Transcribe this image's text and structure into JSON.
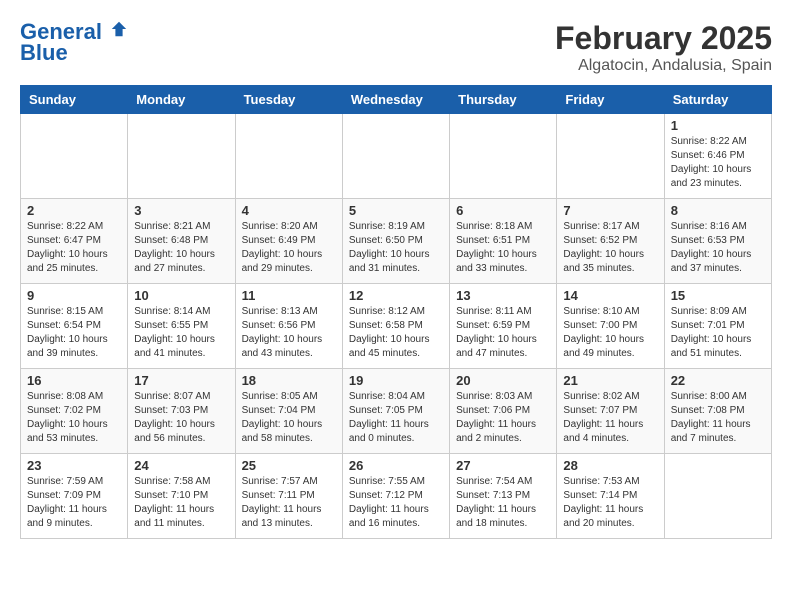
{
  "header": {
    "logo_line1": "General",
    "logo_line2": "Blue",
    "title": "February 2025",
    "subtitle": "Algatocin, Andalusia, Spain"
  },
  "columns": [
    "Sunday",
    "Monday",
    "Tuesday",
    "Wednesday",
    "Thursday",
    "Friday",
    "Saturday"
  ],
  "weeks": [
    [
      {
        "day": "",
        "info": ""
      },
      {
        "day": "",
        "info": ""
      },
      {
        "day": "",
        "info": ""
      },
      {
        "day": "",
        "info": ""
      },
      {
        "day": "",
        "info": ""
      },
      {
        "day": "",
        "info": ""
      },
      {
        "day": "1",
        "info": "Sunrise: 8:22 AM\nSunset: 6:46 PM\nDaylight: 10 hours and 23 minutes."
      }
    ],
    [
      {
        "day": "2",
        "info": "Sunrise: 8:22 AM\nSunset: 6:47 PM\nDaylight: 10 hours and 25 minutes."
      },
      {
        "day": "3",
        "info": "Sunrise: 8:21 AM\nSunset: 6:48 PM\nDaylight: 10 hours and 27 minutes."
      },
      {
        "day": "4",
        "info": "Sunrise: 8:20 AM\nSunset: 6:49 PM\nDaylight: 10 hours and 29 minutes."
      },
      {
        "day": "5",
        "info": "Sunrise: 8:19 AM\nSunset: 6:50 PM\nDaylight: 10 hours and 31 minutes."
      },
      {
        "day": "6",
        "info": "Sunrise: 8:18 AM\nSunset: 6:51 PM\nDaylight: 10 hours and 33 minutes."
      },
      {
        "day": "7",
        "info": "Sunrise: 8:17 AM\nSunset: 6:52 PM\nDaylight: 10 hours and 35 minutes."
      },
      {
        "day": "8",
        "info": "Sunrise: 8:16 AM\nSunset: 6:53 PM\nDaylight: 10 hours and 37 minutes."
      }
    ],
    [
      {
        "day": "9",
        "info": "Sunrise: 8:15 AM\nSunset: 6:54 PM\nDaylight: 10 hours and 39 minutes."
      },
      {
        "day": "10",
        "info": "Sunrise: 8:14 AM\nSunset: 6:55 PM\nDaylight: 10 hours and 41 minutes."
      },
      {
        "day": "11",
        "info": "Sunrise: 8:13 AM\nSunset: 6:56 PM\nDaylight: 10 hours and 43 minutes."
      },
      {
        "day": "12",
        "info": "Sunrise: 8:12 AM\nSunset: 6:58 PM\nDaylight: 10 hours and 45 minutes."
      },
      {
        "day": "13",
        "info": "Sunrise: 8:11 AM\nSunset: 6:59 PM\nDaylight: 10 hours and 47 minutes."
      },
      {
        "day": "14",
        "info": "Sunrise: 8:10 AM\nSunset: 7:00 PM\nDaylight: 10 hours and 49 minutes."
      },
      {
        "day": "15",
        "info": "Sunrise: 8:09 AM\nSunset: 7:01 PM\nDaylight: 10 hours and 51 minutes."
      }
    ],
    [
      {
        "day": "16",
        "info": "Sunrise: 8:08 AM\nSunset: 7:02 PM\nDaylight: 10 hours and 53 minutes."
      },
      {
        "day": "17",
        "info": "Sunrise: 8:07 AM\nSunset: 7:03 PM\nDaylight: 10 hours and 56 minutes."
      },
      {
        "day": "18",
        "info": "Sunrise: 8:05 AM\nSunset: 7:04 PM\nDaylight: 10 hours and 58 minutes."
      },
      {
        "day": "19",
        "info": "Sunrise: 8:04 AM\nSunset: 7:05 PM\nDaylight: 11 hours and 0 minutes."
      },
      {
        "day": "20",
        "info": "Sunrise: 8:03 AM\nSunset: 7:06 PM\nDaylight: 11 hours and 2 minutes."
      },
      {
        "day": "21",
        "info": "Sunrise: 8:02 AM\nSunset: 7:07 PM\nDaylight: 11 hours and 4 minutes."
      },
      {
        "day": "22",
        "info": "Sunrise: 8:00 AM\nSunset: 7:08 PM\nDaylight: 11 hours and 7 minutes."
      }
    ],
    [
      {
        "day": "23",
        "info": "Sunrise: 7:59 AM\nSunset: 7:09 PM\nDaylight: 11 hours and 9 minutes."
      },
      {
        "day": "24",
        "info": "Sunrise: 7:58 AM\nSunset: 7:10 PM\nDaylight: 11 hours and 11 minutes."
      },
      {
        "day": "25",
        "info": "Sunrise: 7:57 AM\nSunset: 7:11 PM\nDaylight: 11 hours and 13 minutes."
      },
      {
        "day": "26",
        "info": "Sunrise: 7:55 AM\nSunset: 7:12 PM\nDaylight: 11 hours and 16 minutes."
      },
      {
        "day": "27",
        "info": "Sunrise: 7:54 AM\nSunset: 7:13 PM\nDaylight: 11 hours and 18 minutes."
      },
      {
        "day": "28",
        "info": "Sunrise: 7:53 AM\nSunset: 7:14 PM\nDaylight: 11 hours and 20 minutes."
      },
      {
        "day": "",
        "info": ""
      }
    ]
  ]
}
